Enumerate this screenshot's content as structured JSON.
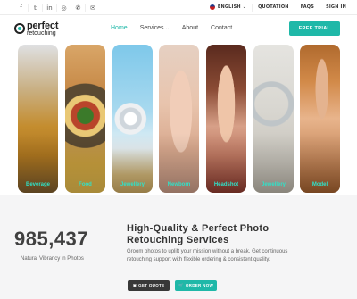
{
  "topbar": {
    "social_icons": [
      "facebook-icon",
      "twitter-icon",
      "linkedin-icon",
      "instagram-icon",
      "phone-icon",
      "mail-icon"
    ],
    "language": "ENGLISH",
    "quotation": "QUOTATION",
    "faqs": "FAQS",
    "signin": "SIGN IN"
  },
  "brand": {
    "line1": "perfect",
    "line2": "retouching"
  },
  "nav": {
    "items": [
      {
        "label": "Home"
      },
      {
        "label": "Services"
      },
      {
        "label": "About"
      },
      {
        "label": "Contact"
      }
    ],
    "cta": "FREE TRIAL"
  },
  "gallery": {
    "cards": [
      {
        "label": "Beverage"
      },
      {
        "label": "Food"
      },
      {
        "label": "Jewellery"
      },
      {
        "label": "Newborn"
      },
      {
        "label": "Headshot"
      },
      {
        "label": "Jewellery"
      },
      {
        "label": "Model"
      }
    ]
  },
  "stats": {
    "number": "985,437",
    "caption": "Natural Vibrancy in Photos",
    "headline_1": "High-Quality & Perfect Photo",
    "headline_2": "Retouching Services",
    "description": "Groom photos to uplift your mission without a break. Get continuous retouching support with flexible ordering & consistent quality.",
    "btn_quote": "GET QUOTE",
    "btn_order": "ORDER NOW"
  },
  "colors": {
    "accent": "#1fb8a8",
    "dark_button": "#383838",
    "section_bg": "#f5f5f6"
  }
}
